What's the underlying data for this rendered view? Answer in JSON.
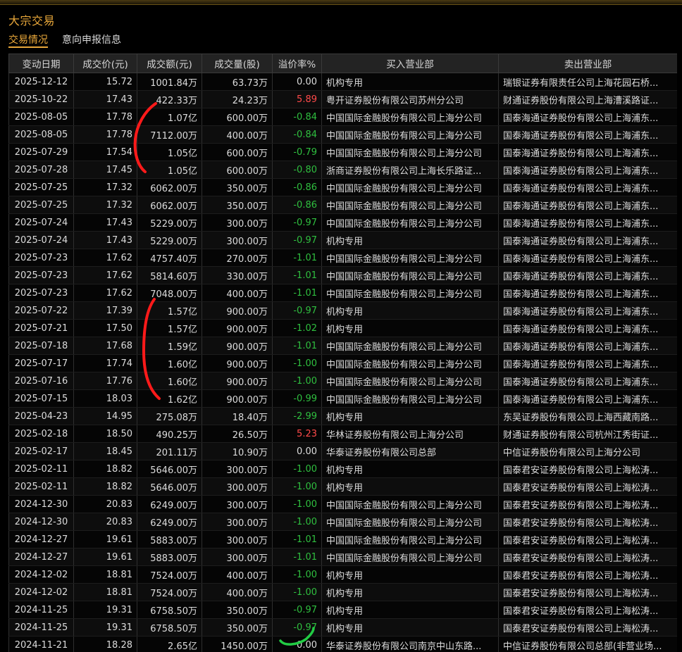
{
  "title": "大宗交易",
  "tabs": [
    {
      "label": "交易情况",
      "active": true
    },
    {
      "label": "意向申报信息",
      "active": false
    }
  ],
  "columns": [
    "变动日期",
    "成交价(元)",
    "成交额(元)",
    "成交量(股)",
    "溢价率%",
    "买入营业部",
    "卖出营业部"
  ],
  "colors": {
    "accent": "#e8a73a",
    "up": "#ff4a4a",
    "down": "#2fbf3f",
    "annotation": "#ff1a1a"
  },
  "rows": [
    [
      "2025-12-12",
      "15.72",
      "1001.84万",
      "63.73万",
      "0.00",
      "机构专用",
      "瑞银证券有限责任公司上海花园石桥..."
    ],
    [
      "2025-10-22",
      "17.43",
      "422.33万",
      "24.23万",
      "5.89",
      "粤开证券股份有限公司苏州分公司",
      "财通证券股份有限公司上海漕溪路证..."
    ],
    [
      "2025-08-05",
      "17.78",
      "1.07亿",
      "600.00万",
      "-0.84",
      "中国国际金融股份有限公司上海分公司",
      "国泰海通证券股份有限公司上海浦东..."
    ],
    [
      "2025-08-05",
      "17.78",
      "7112.00万",
      "400.00万",
      "-0.84",
      "中国国际金融股份有限公司上海分公司",
      "国泰海通证券股份有限公司上海浦东..."
    ],
    [
      "2025-07-29",
      "17.54",
      "1.05亿",
      "600.00万",
      "-0.79",
      "中国国际金融股份有限公司上海分公司",
      "国泰海通证券股份有限公司上海浦东..."
    ],
    [
      "2025-07-28",
      "17.45",
      "1.05亿",
      "600.00万",
      "-0.80",
      "浙商证券股份有限公司上海长乐路证...",
      "国泰海通证券股份有限公司上海浦东..."
    ],
    [
      "2025-07-25",
      "17.32",
      "6062.00万",
      "350.00万",
      "-0.86",
      "中国国际金融股份有限公司上海分公司",
      "国泰海通证券股份有限公司上海浦东..."
    ],
    [
      "2025-07-25",
      "17.32",
      "6062.00万",
      "350.00万",
      "-0.86",
      "中国国际金融股份有限公司上海分公司",
      "国泰海通证券股份有限公司上海浦东..."
    ],
    [
      "2025-07-24",
      "17.43",
      "5229.00万",
      "300.00万",
      "-0.97",
      "中国国际金融股份有限公司上海分公司",
      "国泰海通证券股份有限公司上海浦东..."
    ],
    [
      "2025-07-24",
      "17.43",
      "5229.00万",
      "300.00万",
      "-0.97",
      "机构专用",
      "国泰海通证券股份有限公司上海浦东..."
    ],
    [
      "2025-07-23",
      "17.62",
      "4757.40万",
      "270.00万",
      "-1.01",
      "中国国际金融股份有限公司上海分公司",
      "国泰海通证券股份有限公司上海浦东..."
    ],
    [
      "2025-07-23",
      "17.62",
      "5814.60万",
      "330.00万",
      "-1.01",
      "中国国际金融股份有限公司上海分公司",
      "国泰海通证券股份有限公司上海浦东..."
    ],
    [
      "2025-07-23",
      "17.62",
      "7048.00万",
      "400.00万",
      "-1.01",
      "中国国际金融股份有限公司上海分公司",
      "国泰海通证券股份有限公司上海浦东..."
    ],
    [
      "2025-07-22",
      "17.39",
      "1.57亿",
      "900.00万",
      "-0.97",
      "机构专用",
      "国泰海通证券股份有限公司上海浦东..."
    ],
    [
      "2025-07-21",
      "17.50",
      "1.57亿",
      "900.00万",
      "-1.02",
      "机构专用",
      "国泰海通证券股份有限公司上海浦东..."
    ],
    [
      "2025-07-18",
      "17.68",
      "1.59亿",
      "900.00万",
      "-1.01",
      "中国国际金融股份有限公司上海分公司",
      "国泰海通证券股份有限公司上海浦东..."
    ],
    [
      "2025-07-17",
      "17.74",
      "1.60亿",
      "900.00万",
      "-1.00",
      "中国国际金融股份有限公司上海分公司",
      "国泰海通证券股份有限公司上海浦东..."
    ],
    [
      "2025-07-16",
      "17.76",
      "1.60亿",
      "900.00万",
      "-1.00",
      "中国国际金融股份有限公司上海分公司",
      "国泰海通证券股份有限公司上海浦东..."
    ],
    [
      "2025-07-15",
      "18.03",
      "1.62亿",
      "900.00万",
      "-0.99",
      "中国国际金融股份有限公司上海分公司",
      "国泰海通证券股份有限公司上海浦东..."
    ],
    [
      "2025-04-23",
      "14.95",
      "275.08万",
      "18.40万",
      "-2.99",
      "机构专用",
      "东吴证券股份有限公司上海西藏南路..."
    ],
    [
      "2025-02-18",
      "18.50",
      "490.25万",
      "26.50万",
      "5.23",
      "华林证券股份有限公司上海分公司",
      "财通证券股份有限公司杭州江秀街证..."
    ],
    [
      "2025-02-17",
      "18.45",
      "201.11万",
      "10.90万",
      "0.00",
      "华泰证券股份有限公司总部",
      "中信证券股份有限公司上海分公司"
    ],
    [
      "2025-02-11",
      "18.82",
      "5646.00万",
      "300.00万",
      "-1.00",
      "机构专用",
      "国泰君安证券股份有限公司上海松涛..."
    ],
    [
      "2025-02-11",
      "18.82",
      "5646.00万",
      "300.00万",
      "-1.00",
      "机构专用",
      "国泰君安证券股份有限公司上海松涛..."
    ],
    [
      "2024-12-30",
      "20.83",
      "6249.00万",
      "300.00万",
      "-1.00",
      "中国国际金融股份有限公司上海分公司",
      "国泰君安证券股份有限公司上海松涛..."
    ],
    [
      "2024-12-30",
      "20.83",
      "6249.00万",
      "300.00万",
      "-1.00",
      "中国国际金融股份有限公司上海分公司",
      "国泰君安证券股份有限公司上海松涛..."
    ],
    [
      "2024-12-27",
      "19.61",
      "5883.00万",
      "300.00万",
      "-1.01",
      "中国国际金融股份有限公司上海分公司",
      "国泰君安证券股份有限公司上海松涛..."
    ],
    [
      "2024-12-27",
      "19.61",
      "5883.00万",
      "300.00万",
      "-1.01",
      "中国国际金融股份有限公司上海分公司",
      "国泰君安证券股份有限公司上海松涛..."
    ],
    [
      "2024-12-02",
      "18.81",
      "7524.00万",
      "400.00万",
      "-1.00",
      "机构专用",
      "国泰君安证券股份有限公司上海松涛..."
    ],
    [
      "2024-12-02",
      "18.81",
      "7524.00万",
      "400.00万",
      "-1.00",
      "机构专用",
      "国泰君安证券股份有限公司上海松涛..."
    ],
    [
      "2024-11-25",
      "19.31",
      "6758.50万",
      "350.00万",
      "-0.97",
      "机构专用",
      "国泰君安证券股份有限公司上海松涛..."
    ],
    [
      "2024-11-25",
      "19.31",
      "6758.50万",
      "350.00万",
      "-0.97",
      "机构专用",
      "国泰君安证券股份有限公司上海松涛..."
    ],
    [
      "2024-11-21",
      "18.28",
      "2.65亿",
      "1450.00万",
      "0.00",
      "华泰证券股份有限公司南京中山东路...",
      "中信证券股份有限公司总部(非营业场..."
    ]
  ]
}
